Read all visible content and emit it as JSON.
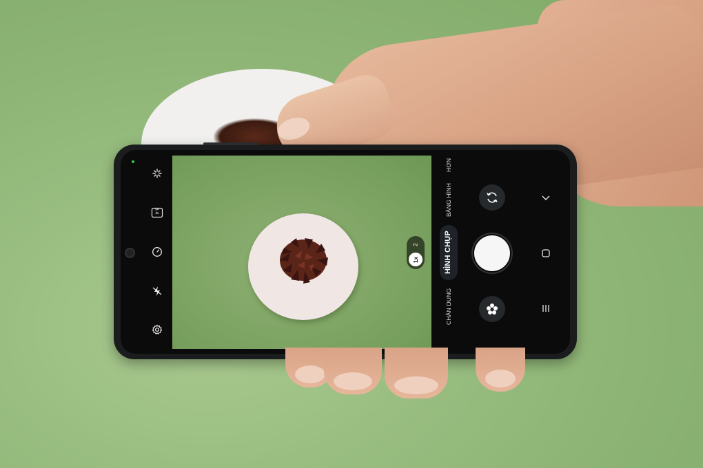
{
  "camera": {
    "modes": {
      "more": "HƠN",
      "video": "BĂNG HÌNH",
      "photo": "HÌNH CHỤP",
      "portrait": "CHÂN DUNG"
    },
    "zoom": {
      "current": "1x",
      "alt": "2"
    },
    "left_controls": [
      "sparkle-icon",
      "aspect-ratio-icon",
      "timer-icon",
      "flash-off-icon",
      "settings-icon"
    ],
    "aspect_ratio_label": "3:4"
  }
}
